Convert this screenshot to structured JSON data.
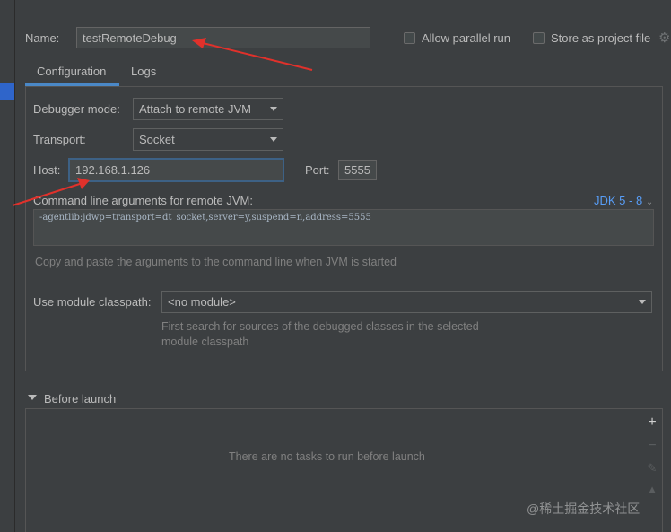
{
  "form": {
    "name_label": "Name:",
    "name_value": "testRemoteDebug",
    "allow_parallel_label": "Allow parallel run",
    "store_project_label": "Store as project file"
  },
  "tabs": [
    {
      "label": "Configuration",
      "selected": true
    },
    {
      "label": "Logs",
      "selected": false
    }
  ],
  "config": {
    "debugger_mode_label": "Debugger mode:",
    "debugger_mode_value": "Attach to remote JVM",
    "transport_label": "Transport:",
    "transport_value": "Socket",
    "host_label": "Host:",
    "host_value": "192.168.1.126",
    "port_label": "Port:",
    "port_value": "5555",
    "cmd_label": "Command line arguments for remote JVM:",
    "jdk_link": "JDK 5 - 8",
    "cmd_value": "-agentlib:jdwp=transport=dt_socket,server=y,suspend=n,address=5555",
    "cmd_hint": "Copy and paste the arguments to the command line when JVM is started",
    "module_label": "Use module classpath:",
    "module_value": "<no module>",
    "module_hint_line1": "First search for sources of the debugged classes in the selected",
    "module_hint_line2": "module classpath"
  },
  "before_launch": {
    "title": "Before launch",
    "empty_text": "There are no tasks to run before launch",
    "add_icon": "+",
    "remove_icon": "−"
  },
  "watermark": "@稀土掘金技术社区",
  "colors": {
    "background": "#3c3f41",
    "accent": "#4a88c7",
    "link": "#589df6",
    "annotation_arrow": "#e0312b"
  }
}
